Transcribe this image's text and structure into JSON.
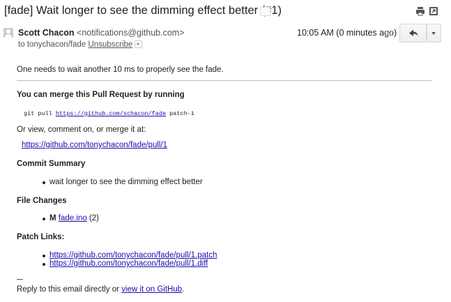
{
  "header": {
    "subject": "[fade] Wait longer to see the dimming effect better (#1)",
    "icons": [
      "print-icon",
      "new-window-icon"
    ]
  },
  "message": {
    "sender_name": "Scott Chacon",
    "sender_email": "<notifications@github.com>",
    "to_prefix": "to tonychacon/fade",
    "unsubscribe": "Unsubscribe",
    "time": "10:05 AM (0 minutes ago)",
    "reply_icon": "reply-icon",
    "star_icon": "star-icon"
  },
  "body": {
    "intro": "One needs to wait another 10 ms to properly see the fade.",
    "merge_heading": "You can merge this Pull Request by running",
    "git_cmd_prefix": "git pull",
    "git_url": "https://github.com/schacon/fade",
    "git_cmd_suffix": "patch-1",
    "or_view": "Or view, comment on, or merge it at:",
    "pr_link": "https://github.com/tonychacon/fade/pull/1",
    "commit_heading": "Commit Summary",
    "commit_items": [
      "wait longer to see the dimming effect better"
    ],
    "file_heading": "File Changes",
    "file_status": "M",
    "file_name": "fade.ino",
    "file_count": "(2)",
    "patch_heading": "Patch Links:",
    "patch_links": [
      "https://github.com/tonychacon/fade/pull/1.patch",
      "https://github.com/tonychacon/fade/pull/1.diff"
    ],
    "footer_prefix": "Reply to this email directly or",
    "footer_link": "view it on GitHub",
    "footer_suffix": "."
  }
}
